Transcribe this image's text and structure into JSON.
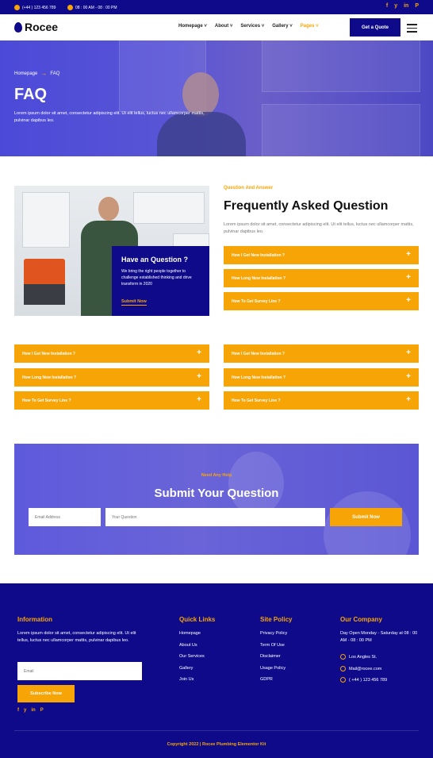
{
  "topbar": {
    "phone": "(+44 ) 123 456 789",
    "hours": "08 : 00 AM - 08 : 00 PM",
    "social": [
      "f",
      "y",
      "in",
      "P"
    ]
  },
  "header": {
    "logo": "Rocee",
    "nav": [
      "Homepage",
      "About",
      "Services",
      "Gallery",
      "Pages"
    ],
    "cta": "Get a Quote"
  },
  "hero": {
    "breadcrumb_home": "Homepage",
    "breadcrumb_current": "FAQ",
    "title": "FAQ",
    "text": "Lorem ipsum dolor sit amet, consectetur adipiscing elit. Ut elit tellus, luctus nec ullamcorper mattis, pulvinar dapibus leo."
  },
  "help_card": {
    "title": "Have an Question ?",
    "text": "We bring the right people together to challenge established thinking and drive transform in 2020",
    "link": "Submit Now"
  },
  "faq": {
    "label": "Question And Answer",
    "title": "Frequently Asked Question",
    "text": "Lorem ipsum dolor sit amet, consectetur adipiscing elit. Ut elit tellus, luctus nec ullamcorper mattis, pulvinar dapibus leo.",
    "items": [
      "How I Get New Installation ?",
      "How Long New Installation ?",
      "How To Get Survey Line ?"
    ],
    "left_items": [
      "How I Get New Installation ?",
      "How Long New Installation ?",
      "How To Get Survey Line ?"
    ],
    "right_items": [
      "How I Get New Installation ?",
      "How Long New Installation ?",
      "How To Get Survey Line ?"
    ]
  },
  "ask": {
    "label": "Need Any Help",
    "title": "Submit Your Question",
    "email_placeholder": "Email Address",
    "question_placeholder": "Your Question",
    "button": "Submit Now"
  },
  "footer": {
    "info_title": "Information",
    "info_text": "Lorem ipsum dolor sit amet, consectetur adipiscing elit. Ut elit tellus, luctus nec ullamcorper mattis, pulvinar dapibus leo.",
    "email_placeholder": "Email",
    "subscribe": "Subscribe Now",
    "social": [
      "f",
      "y",
      "in",
      "P"
    ],
    "quick_title": "Quick Links",
    "quick_links": [
      "Homepage",
      "About Us",
      "Our Services",
      "Gallery",
      "Join Us"
    ],
    "policy_title": "Site Policy",
    "policy_links": [
      "Privacy Policy",
      "Term Of Use",
      "Disclaimer",
      "Usage Policy",
      "GDPR"
    ],
    "company_title": "Our Company",
    "company_hours": "Day Open Monday - Saturday at 08 : 00 AM - 08 : 00 PM",
    "address": "Los Angles St.",
    "mail": "Mail@rocee.com",
    "phone": "( +44 ) 123 456 789",
    "copyright": "Copyright 2022 | Rocee Plumbing Elementor Kit"
  },
  "colors": {
    "primary": "#0e0a8a",
    "accent": "#f7a506"
  }
}
